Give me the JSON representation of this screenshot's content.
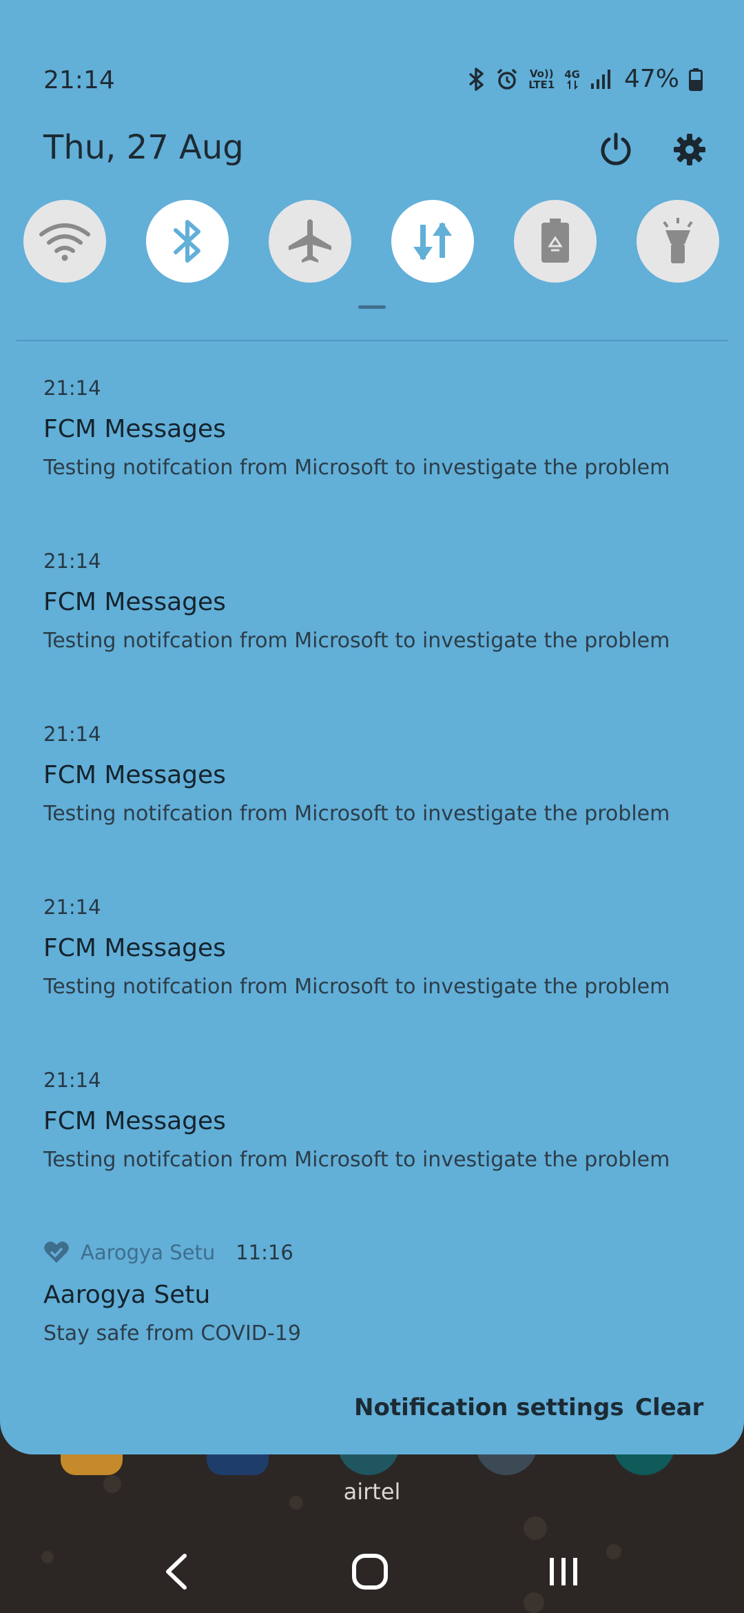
{
  "status_bar": {
    "time": "21:14",
    "network_volte": "Vo))",
    "network_lte": "LTE1",
    "network_4g": "4G",
    "battery": "47%"
  },
  "header": {
    "date": "Thu, 27 Aug"
  },
  "quick_settings": [
    {
      "name": "wifi",
      "state": "off"
    },
    {
      "name": "bluetooth",
      "state": "on"
    },
    {
      "name": "airplane",
      "state": "off"
    },
    {
      "name": "mobile-data",
      "state": "on"
    },
    {
      "name": "power-saving",
      "state": "off"
    },
    {
      "name": "flashlight",
      "state": "off"
    }
  ],
  "notifications": [
    {
      "time": "21:14",
      "title": "FCM Messages",
      "text": "Testing notifcation from Microsoft to investigate the problem"
    },
    {
      "time": "21:14",
      "title": "FCM Messages",
      "text": "Testing notifcation from Microsoft to investigate the problem"
    },
    {
      "time": "21:14",
      "title": "FCM Messages",
      "text": "Testing notifcation from Microsoft to investigate the problem"
    },
    {
      "time": "21:14",
      "title": "FCM Messages",
      "text": "Testing notifcation from Microsoft to investigate the problem"
    },
    {
      "time": "21:14",
      "title": "FCM Messages",
      "text": "Testing notifcation from Microsoft to investigate the problem"
    }
  ],
  "app_notification": {
    "app_name": "Aarogya Setu",
    "time": "11:16",
    "title": "Aarogya Setu",
    "text": "Stay safe from COVID-19"
  },
  "footer": {
    "settings_label": "Notification settings",
    "clear_label": "Clear"
  },
  "carrier": "airtel",
  "colors": {
    "shade": "#62afd8",
    "tile_on": "#ffffff",
    "tile_off": "#e6e6e6",
    "tile_on_icon": "#62afd8",
    "tile_off_icon": "#8a8a8a"
  }
}
